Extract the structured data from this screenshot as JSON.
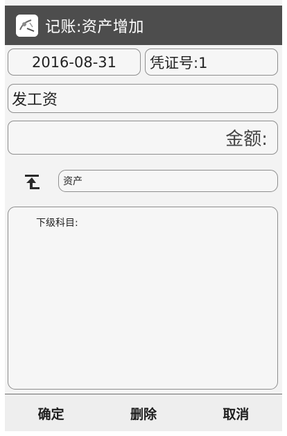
{
  "titlebar": {
    "app_icon": "app-logo-icon",
    "title": "记账:资产增加"
  },
  "form": {
    "date": "2016-08-31",
    "voucher": "凭证号:1",
    "summary": "发工资",
    "amount_label": "金额:",
    "up_icon": "level-up-icon",
    "account": "资产",
    "sub_accounts_label": "下级科目:"
  },
  "actions": {
    "confirm": "确定",
    "delete": "删除",
    "cancel": "取消"
  }
}
